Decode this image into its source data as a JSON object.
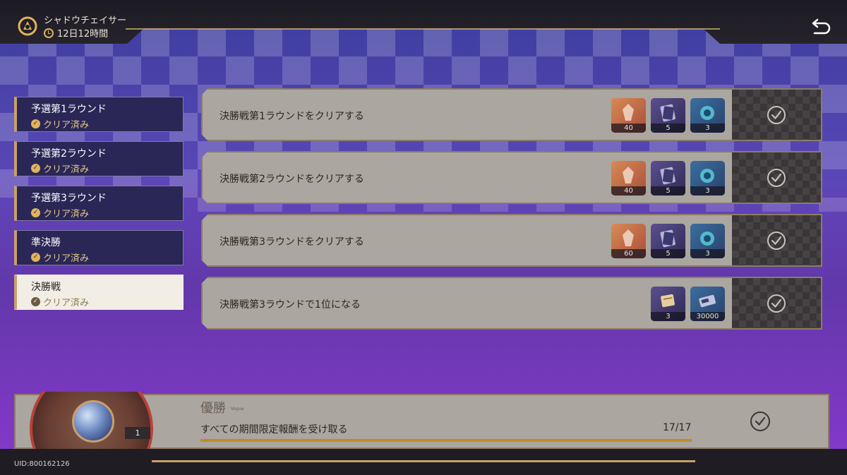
{
  "event": {
    "title": "シャドウチェイサー",
    "timer": "12日12時間"
  },
  "sidebar": {
    "tabs": [
      {
        "label": "予選第1ラウンド",
        "status": "クリア済み"
      },
      {
        "label": "予選第2ラウンド",
        "status": "クリア済み"
      },
      {
        "label": "予選第3ラウンド",
        "status": "クリア済み"
      },
      {
        "label": "準決勝",
        "status": "クリア済み"
      },
      {
        "label": "決勝戦",
        "status": "クリア済み"
      }
    ],
    "active_index": 4
  },
  "missions": [
    {
      "text": "決勝戦第1ラウンドをクリアする",
      "rewards": [
        {
          "icon": "crystal-icon",
          "qty": "40"
        },
        {
          "icon": "card-pack-icon",
          "qty": "5"
        },
        {
          "icon": "blue-orb-icon",
          "qty": "3"
        }
      ],
      "claimed": true
    },
    {
      "text": "決勝戦第2ラウンドをクリアする",
      "rewards": [
        {
          "icon": "crystal-icon",
          "qty": "40"
        },
        {
          "icon": "card-pack-icon",
          "qty": "5"
        },
        {
          "icon": "blue-orb-icon",
          "qty": "3"
        }
      ],
      "claimed": true
    },
    {
      "text": "決勝戦第3ラウンドをクリアする",
      "rewards": [
        {
          "icon": "crystal-icon",
          "qty": "60"
        },
        {
          "icon": "card-pack-icon",
          "qty": "5"
        },
        {
          "icon": "blue-orb-icon",
          "qty": "3"
        }
      ],
      "claimed": true
    },
    {
      "text": "決勝戦第3ラウンドで1位になる",
      "rewards": [
        {
          "icon": "scroll-icon",
          "qty": "3"
        },
        {
          "icon": "coin-card-icon",
          "qty": "30000"
        }
      ],
      "claimed": true
    }
  ],
  "final_reward": {
    "title": "優勝",
    "subtitle": "Vogue",
    "description": "すべての期間限定報酬を受け取る",
    "progress": "17/17",
    "progress_fraction": 1.0,
    "item_count": "1",
    "claimed": true
  },
  "footer": {
    "uid": "UID:800162126"
  },
  "colors": {
    "accent_gold": "#c9a06a",
    "panel": "#aba69f",
    "tab_bg": "#2a2757",
    "tab_active_bg": "#f2ede5",
    "progress_bar": "#c08a2a"
  }
}
